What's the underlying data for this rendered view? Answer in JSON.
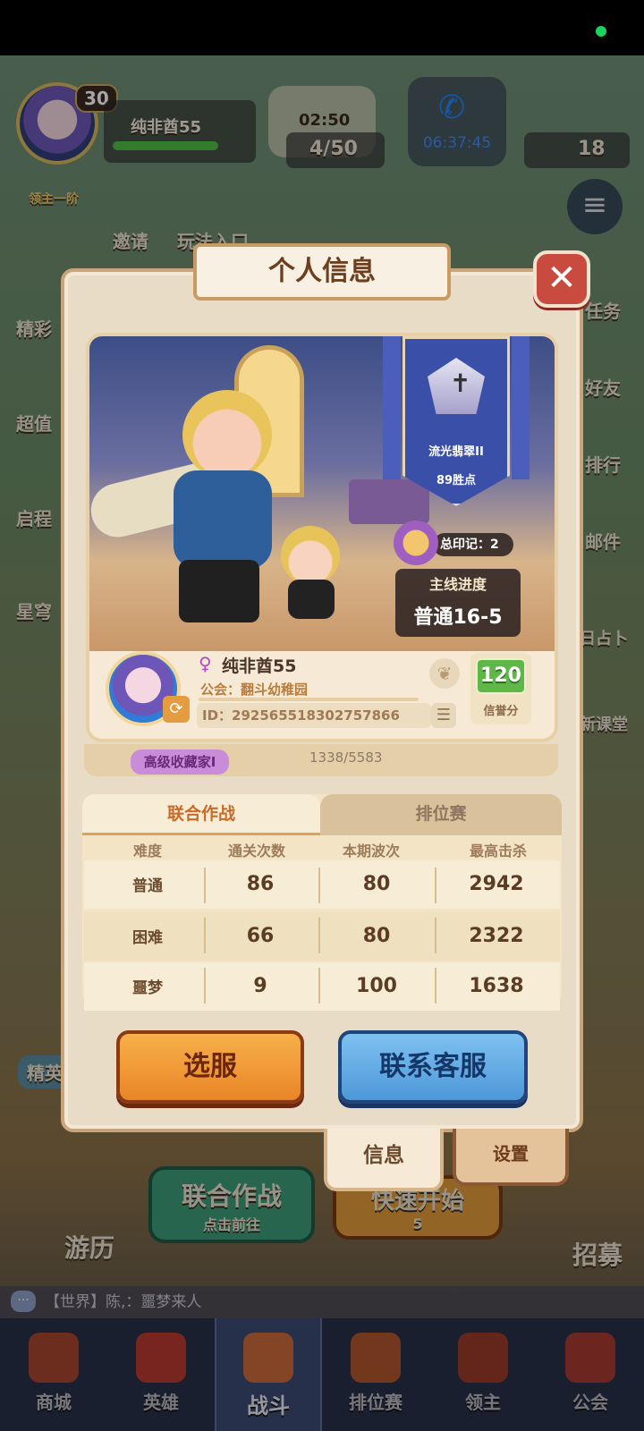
{
  "status_bar": {
    "dot_color": "#19d35a"
  },
  "top_hud": {
    "player_level": "30",
    "player_name": "纯非酋55",
    "lord_label": "领主一阶",
    "timer": "02:50",
    "stamina": "4/50",
    "call_time": "06:37:45",
    "gems": "18",
    "invite_label": "邀请",
    "gameplay_label": "玩法入口"
  },
  "side_menu": {
    "left": [
      "精彩",
      "超值",
      "启程",
      "星穹"
    ],
    "right": [
      "任务",
      "好友",
      "排行",
      "邮件",
      "每日占卜",
      "萌新课堂"
    ]
  },
  "scene_labels": {
    "elite": "精英",
    "travel": "游历",
    "coop_title": "联合作战",
    "coop_sub": "点击前往",
    "quick_start": "快速开始",
    "quick_cost": "5",
    "recruit": "招募"
  },
  "chat": {
    "text": "【世界】陈,：噩梦来人"
  },
  "bottom_nav": [
    {
      "label": "商城"
    },
    {
      "label": "英雄"
    },
    {
      "label": "战斗"
    },
    {
      "label": "排位赛"
    },
    {
      "label": "领主"
    },
    {
      "label": "公会"
    }
  ],
  "dialog": {
    "title": "个人信息",
    "close_symbol": "✕",
    "rank": {
      "name": "流光翡翠II",
      "points": "89胜点"
    },
    "marks": "总印记：2",
    "main_progress_label": "主线进度",
    "main_progress_value": "普通16-5",
    "player": {
      "name": "纯非酋55",
      "guild": "公会：翻斗幼稚园",
      "id": "ID：29256551830275786​6",
      "credit_score": "120",
      "credit_label": "信誉分"
    },
    "collector": {
      "title": "高级收藏家I",
      "count": "1338/5583"
    },
    "stats": {
      "tabs": {
        "active": "联合作战",
        "inactive": "排位赛"
      },
      "columns": [
        "难度",
        "通关次数",
        "本期波次",
        "最高击杀"
      ],
      "rows": [
        {
          "difficulty": "普通",
          "clears": "86",
          "waves": "80",
          "kills": "2942"
        },
        {
          "difficulty": "困难",
          "clears": "66",
          "waves": "80",
          "kills": "2322"
        },
        {
          "difficulty": "噩梦",
          "clears": "9",
          "waves": "100",
          "kills": "1638"
        }
      ]
    },
    "buttons": {
      "select_server": "选服",
      "contact_support": "联系客服"
    },
    "bottom_tabs": {
      "info": "信息",
      "settings": "设置"
    }
  }
}
